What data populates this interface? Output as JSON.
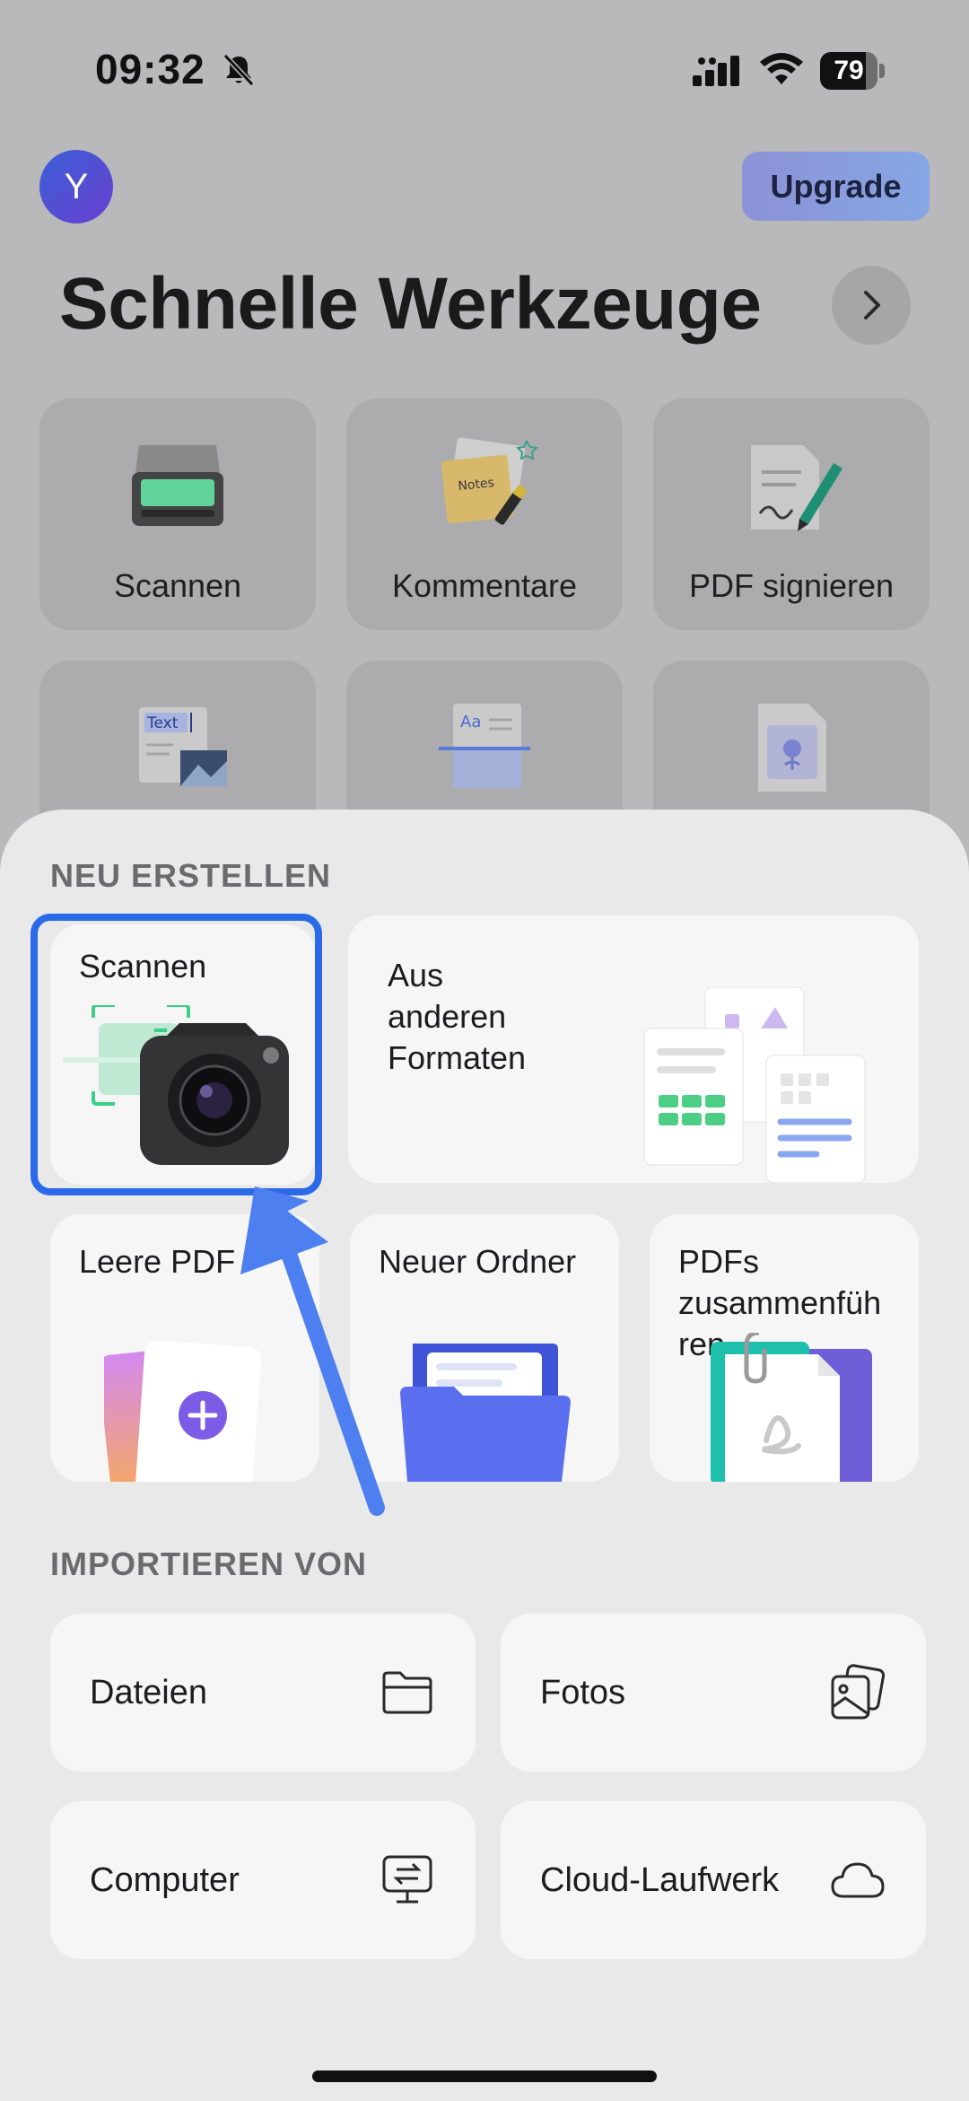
{
  "status_bar": {
    "time": "09:32",
    "battery": "79",
    "battery_level": 0.79
  },
  "header": {
    "avatar_initial": "Y",
    "upgrade_label": "Upgrade",
    "title": "Schnelle Werkzeuge"
  },
  "quick_tools": [
    {
      "label": "Scannen",
      "icon": "scanner-icon"
    },
    {
      "label": "Kommentare",
      "icon": "sticky-notes-icon"
    },
    {
      "label": "PDF signieren",
      "icon": "pen-sign-icon"
    },
    {
      "label": "",
      "icon": "text-image-icon",
      "icon_text": "Text"
    },
    {
      "label": "",
      "icon": "ocr-document-icon",
      "icon_text": "Aa"
    },
    {
      "label": "",
      "icon": "image-file-icon"
    }
  ],
  "sheet": {
    "create_title": "NEU ERSTELLEN",
    "create": {
      "scan": "Scannen",
      "other_formats": [
        "Aus",
        "anderen",
        "Formaten"
      ],
      "blank_pdf": "Leere PDF",
      "new_folder": "Neuer Ordner",
      "merge_pdfs": [
        "PDFs",
        "zusammenfüh",
        "ren"
      ]
    },
    "import_title": "IMPORTIEREN VON",
    "import": [
      {
        "label": "Dateien",
        "icon": "folder-icon"
      },
      {
        "label": "Fotos",
        "icon": "photos-icon"
      },
      {
        "label": "Computer",
        "icon": "computer-transfer-icon"
      },
      {
        "label": "Cloud-Laufwerk",
        "icon": "cloud-icon"
      }
    ]
  },
  "colors": {
    "highlight": "#2a6ae8",
    "arrow": "#4d7ff0",
    "accent_purple": "#7c5ce6"
  }
}
